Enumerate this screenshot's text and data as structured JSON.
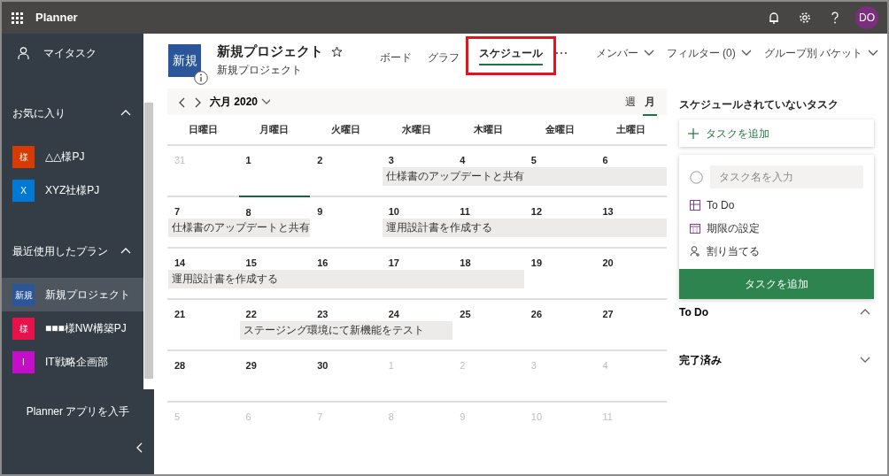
{
  "app_bar": {
    "title": "Planner",
    "avatar": "DO"
  },
  "sidebar": {
    "my_tasks": "マイタスク",
    "sections": [
      {
        "title": "お気に入り",
        "expanded": true,
        "items": [
          {
            "badge": "様",
            "name": "△△様PJ",
            "color": "#d83b01",
            "selected": false
          },
          {
            "badge": "X",
            "name": "XYZ社様PJ",
            "color": "#0078d4",
            "selected": false
          }
        ]
      },
      {
        "title": "最近使用したプラン",
        "expanded": true,
        "items": [
          {
            "badge": "新規",
            "name": "新規プロジェクト",
            "color": "#2b579a",
            "selected": true
          },
          {
            "badge": "様",
            "name": "■■■様NW構築PJ",
            "color": "#e8114a",
            "selected": false
          },
          {
            "badge": "I",
            "name": "IT戦略企画部",
            "color": "#c30fc9",
            "selected": false
          }
        ]
      }
    ],
    "get_app": "Planner アプリを入手"
  },
  "plan": {
    "badge": "新規",
    "title": "新規プロジェクト",
    "favorite": false,
    "subtitle": "新規プロジェクト"
  },
  "tabs": [
    {
      "label": "ボード",
      "selected": false,
      "highlighted": false
    },
    {
      "label": "グラフ",
      "selected": false,
      "highlighted": false
    },
    {
      "label": "スケジュール",
      "selected": true,
      "highlighted": true
    }
  ],
  "filters": [
    {
      "label": "メンバー"
    },
    {
      "label": "フィルター (0)"
    },
    {
      "label": "グループ別 バケット"
    }
  ],
  "calendar": {
    "month": "六月 2020",
    "views": [
      {
        "label": "週",
        "selected": false
      },
      {
        "label": "月",
        "selected": true
      }
    ],
    "weekdays": [
      "日曜日",
      "月曜日",
      "火曜日",
      "水曜日",
      "木曜日",
      "金曜日",
      "土曜日"
    ],
    "weeks": [
      {
        "days": [
          {
            "label": "31",
            "other_month": true,
            "today": false
          },
          {
            "label": "1",
            "other_month": false,
            "today": false
          },
          {
            "label": "2",
            "other_month": false,
            "today": false
          },
          {
            "label": "3",
            "other_month": false,
            "today": false,
            "event": "仕様書のアップデートと共有"
          },
          {
            "label": "4",
            "other_month": false,
            "today": false,
            "continues": true
          },
          {
            "label": "5",
            "other_month": false,
            "today": false,
            "continues": true
          },
          {
            "label": "6",
            "other_month": false,
            "today": false,
            "continues": true
          }
        ]
      },
      {
        "days": [
          {
            "label": "7",
            "other_month": false,
            "today": false,
            "event": "仕様書のアップデートと共有"
          },
          {
            "label": "8",
            "other_month": false,
            "today": true,
            "continues": true
          },
          {
            "label": "9",
            "other_month": false,
            "today": false
          },
          {
            "label": "10",
            "other_month": false,
            "today": false,
            "event": "運用設計書を作成する"
          },
          {
            "label": "11",
            "other_month": false,
            "today": false,
            "continues": true
          },
          {
            "label": "12",
            "other_month": false,
            "today": false,
            "continues": true
          },
          {
            "label": "13",
            "other_month": false,
            "today": false,
            "continues": true
          }
        ]
      },
      {
        "days": [
          {
            "label": "14",
            "other_month": false,
            "today": false,
            "event": "運用設計書を作成する"
          },
          {
            "label": "15",
            "other_month": false,
            "today": false,
            "continues": true
          },
          {
            "label": "16",
            "other_month": false,
            "today": false,
            "continues": true
          },
          {
            "label": "17",
            "other_month": false,
            "today": false,
            "continues": true
          },
          {
            "label": "18",
            "other_month": false,
            "today": false,
            "continues": true
          },
          {
            "label": "19",
            "other_month": false,
            "today": false
          },
          {
            "label": "20",
            "other_month": false,
            "today": false
          }
        ]
      },
      {
        "days": [
          {
            "label": "21",
            "other_month": false,
            "today": false
          },
          {
            "label": "22",
            "other_month": false,
            "today": false,
            "event": "ステージング環境にて新機能をテスト"
          },
          {
            "label": "23",
            "other_month": false,
            "today": false,
            "continues": true
          },
          {
            "label": "24",
            "other_month": false,
            "today": false,
            "continues": true
          },
          {
            "label": "25",
            "other_month": false,
            "today": false
          },
          {
            "label": "26",
            "other_month": false,
            "today": false
          },
          {
            "label": "27",
            "other_month": false,
            "today": false
          }
        ]
      },
      {
        "days": [
          {
            "label": "28",
            "other_month": false,
            "today": false
          },
          {
            "label": "29",
            "other_month": false,
            "today": false
          },
          {
            "label": "30",
            "other_month": false,
            "today": false
          },
          {
            "label": "1",
            "other_month": true,
            "today": false
          },
          {
            "label": "2",
            "other_month": true,
            "today": false
          },
          {
            "label": "3",
            "other_month": true,
            "today": false
          },
          {
            "label": "4",
            "other_month": true,
            "today": false
          }
        ]
      },
      {
        "days": [
          {
            "label": "5",
            "other_month": true,
            "today": false
          },
          {
            "label": "6",
            "other_month": true,
            "today": false
          },
          {
            "label": "7",
            "other_month": true,
            "today": false
          },
          {
            "label": "8",
            "other_month": true,
            "today": false
          },
          {
            "label": "9",
            "other_month": true,
            "today": false
          },
          {
            "label": "10",
            "other_month": true,
            "today": false
          },
          {
            "label": "11",
            "other_month": true,
            "today": false
          }
        ]
      }
    ]
  },
  "unscheduled": {
    "title": "スケジュールされていないタスク",
    "add_label": "タスクを追加",
    "form": {
      "placeholder": "タスク名を入力",
      "options": [
        {
          "kind": "bucket",
          "label": "To Do"
        },
        {
          "kind": "due",
          "label": "期限の設定"
        },
        {
          "kind": "assign",
          "label": "割り当てる"
        }
      ],
      "submit": "タスクを追加"
    },
    "groups": [
      {
        "title": "To Do",
        "expanded": true
      },
      {
        "title": "完了済み",
        "expanded": false
      }
    ]
  }
}
